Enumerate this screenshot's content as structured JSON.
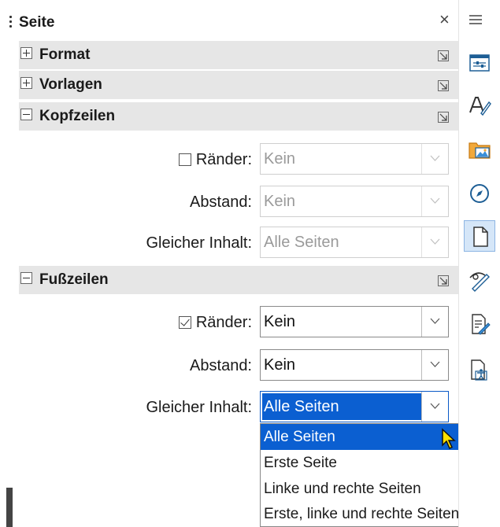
{
  "panel": {
    "title": "Seite",
    "close_glyph": "×",
    "sections": {
      "format": {
        "label": "Format",
        "state": "collapsed"
      },
      "vorlagen": {
        "label": "Vorlagen",
        "state": "collapsed"
      },
      "kopfzeilen": {
        "label": "Kopfzeilen",
        "state": "expanded",
        "raender": {
          "label": "Ränder:",
          "checked": false,
          "value": "Kein"
        },
        "abstand": {
          "label": "Abstand:",
          "value": "Kein"
        },
        "inhalt": {
          "label": "Gleicher Inhalt:",
          "value": "Alle Seiten"
        }
      },
      "fusszeilen": {
        "label": "Fußzeilen",
        "state": "expanded",
        "raender": {
          "label": "Ränder:",
          "checked": true,
          "value": "Kein"
        },
        "abstand": {
          "label": "Abstand:",
          "value": "Kein"
        },
        "inhalt": {
          "label": "Gleicher Inhalt:",
          "value": "Alle Seiten"
        }
      }
    },
    "dropdown": {
      "options": [
        "Alle Seiten",
        "Erste Seite",
        "Linke und rechte Seiten",
        "Erste, linke und rechte Seiten"
      ],
      "highlighted": "Alle Seiten"
    }
  },
  "sidebar": {
    "icons": [
      "menu-icon",
      "properties-icon",
      "styles-icon",
      "gallery-icon",
      "navigator-icon",
      "page-icon",
      "style-inspector-icon",
      "manage-changes-icon",
      "accessibility-check-icon"
    ],
    "active": "page-icon"
  },
  "colors": {
    "selection": "#0b5fd1",
    "section_bg": "#e6e6e6",
    "active_tab": "#d5e6f8"
  }
}
